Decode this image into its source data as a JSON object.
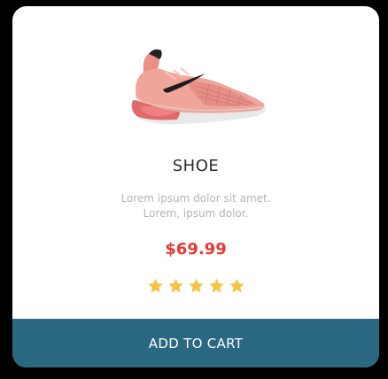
{
  "product": {
    "title": "SHOE",
    "description_line1": "Lorem ipsum dolor sit amet.",
    "description_line2": "Lorem, ipsum dolor.",
    "price": "$69.99",
    "rating": 5,
    "rating_max": 5,
    "image_icon": "sneaker-image"
  },
  "actions": {
    "add_to_cart_label": "ADD TO CART"
  },
  "colors": {
    "button_bg": "#2a6882",
    "price": "#e53935",
    "star": "#f6c342",
    "background": "#000000",
    "card": "#ffffff"
  }
}
